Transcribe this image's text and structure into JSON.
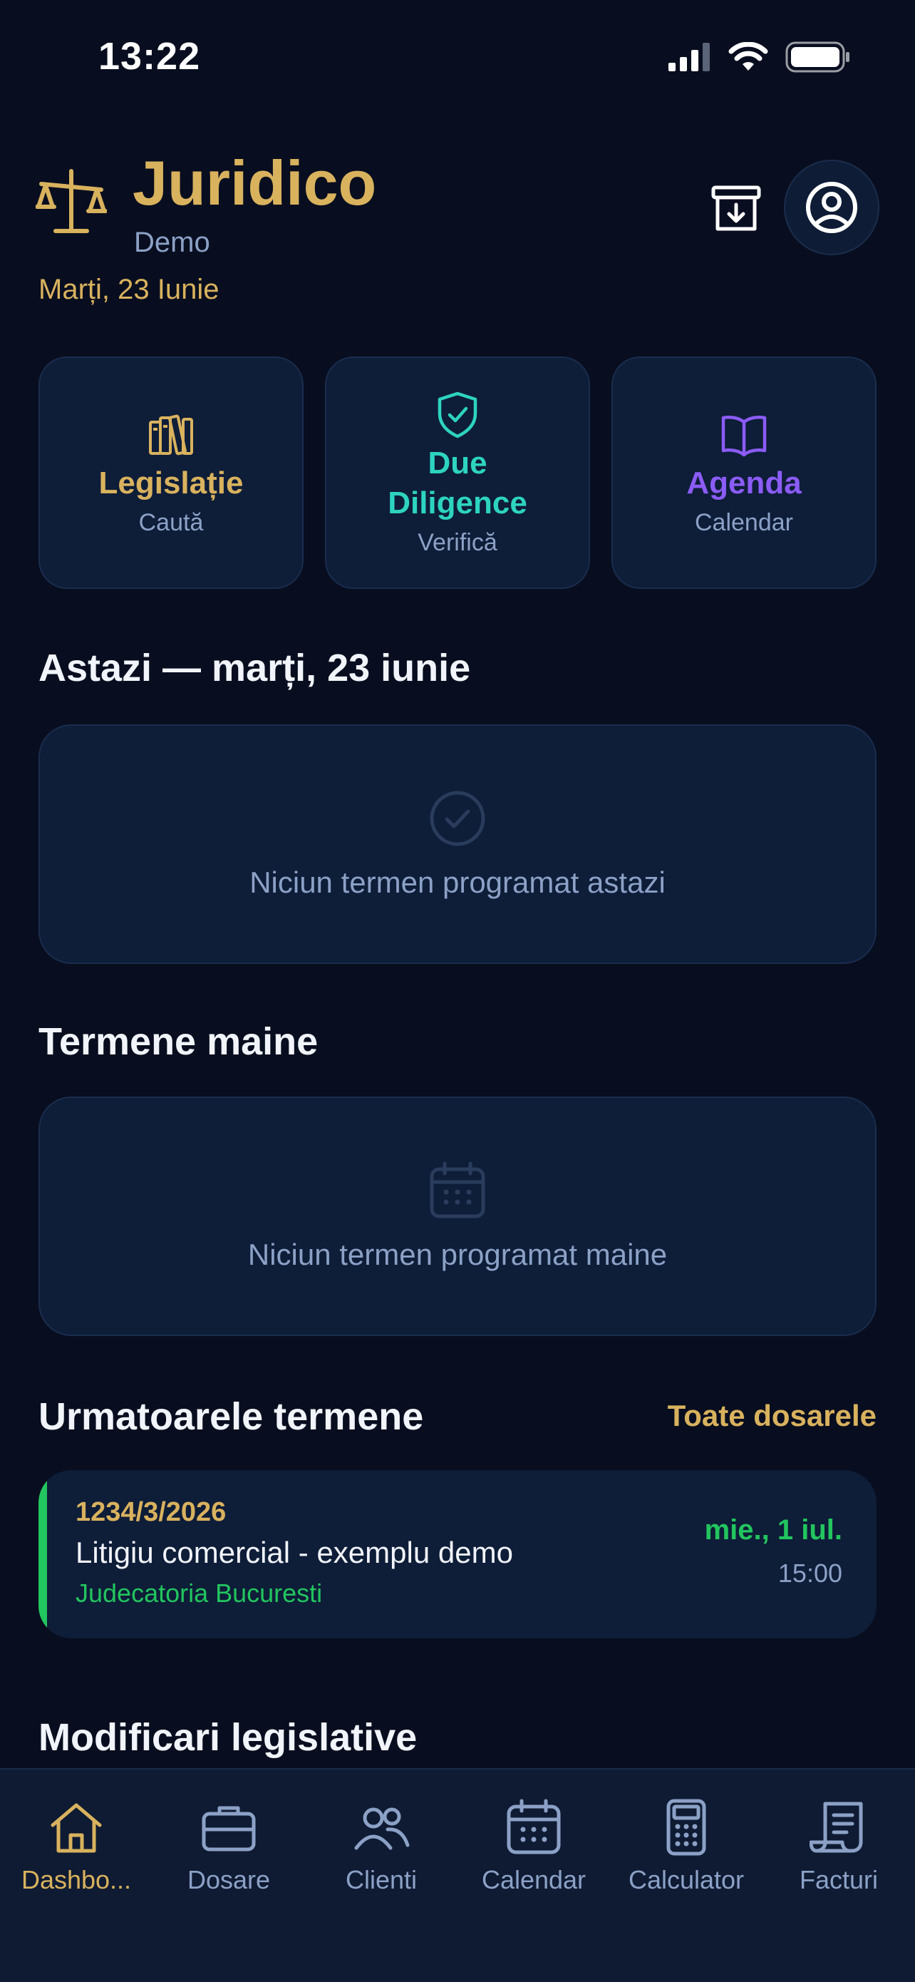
{
  "status_bar": {
    "time": "13:22"
  },
  "header": {
    "title": "Juridico",
    "subtitle": "Demo",
    "date": "Marți, 23 Iunie"
  },
  "quick_actions": [
    {
      "title": "Legislație",
      "subtitle": "Caută",
      "color": "#D9B25E",
      "icon": "books-icon"
    },
    {
      "title": "Due Diligence",
      "subtitle": "Verifică",
      "color": "#2DD4BF",
      "icon": "shield-check-icon"
    },
    {
      "title": "Agenda",
      "subtitle": "Calendar",
      "color": "#8B5CF6",
      "icon": "open-book-icon"
    }
  ],
  "today": {
    "title": "Astazi — marți, 23 iunie",
    "empty_text": "Niciun termen programat astazi"
  },
  "tomorrow": {
    "title": "Termene maine",
    "empty_text": "Niciun termen programat maine"
  },
  "upcoming": {
    "title": "Urmatoarele termene",
    "link": "Toate dosarele",
    "items": [
      {
        "number": "1234/3/2026",
        "title": "Litigiu comercial - exemplu demo",
        "court": "Judecatoria Bucuresti",
        "date": "mie., 1 iul.",
        "time": "15:00"
      }
    ]
  },
  "legislative": {
    "title": "Modificari legislative"
  },
  "tabs": [
    {
      "label": "Dashbo...",
      "icon": "home-icon",
      "active": true
    },
    {
      "label": "Dosare",
      "icon": "briefcase-icon",
      "active": false
    },
    {
      "label": "Clienti",
      "icon": "users-icon",
      "active": false
    },
    {
      "label": "Calendar",
      "icon": "calendar-icon",
      "active": false
    },
    {
      "label": "Calculator",
      "icon": "calculator-icon",
      "active": false
    },
    {
      "label": "Facturi",
      "icon": "receipt-icon",
      "active": false
    }
  ],
  "colors": {
    "accent_gold": "#D9B25E",
    "teal": "#2DD4BF",
    "purple": "#8B5CF6",
    "green": "#22C55E",
    "background": "#080E1F",
    "card": "#0E1D38"
  }
}
